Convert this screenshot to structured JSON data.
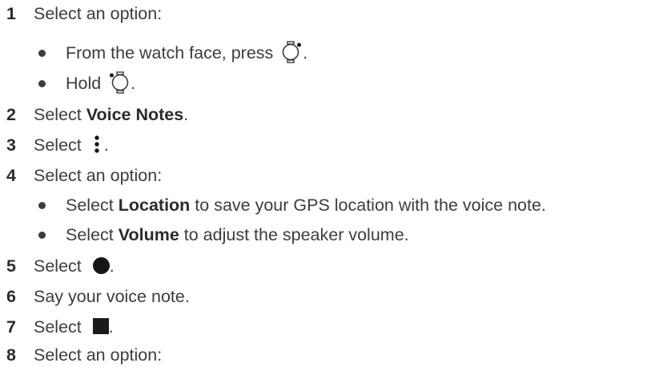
{
  "steps": [
    {
      "num": "1",
      "text": "Select an option:"
    },
    {
      "sub": {
        "pre": "From the watch face, press ",
        "post": "."
      }
    },
    {
      "sub": {
        "pre": "Hold ",
        "post": "."
      }
    },
    {
      "num": "2",
      "pre": "Select ",
      "bold": "Voice Notes",
      "post": "."
    },
    {
      "num": "3",
      "pre": "Select ",
      "post": "."
    },
    {
      "num": "4",
      "text": "Select an option:"
    },
    {
      "sub": {
        "pre": "Select ",
        "bold": "Location",
        "post": " to save your GPS location with the voice note."
      }
    },
    {
      "sub": {
        "pre": "Select ",
        "bold": "Volume",
        "post": " to adjust the speaker volume."
      }
    },
    {
      "num": "5",
      "pre": "Select ",
      "post": "."
    },
    {
      "num": "6",
      "text": "Say your voice note."
    },
    {
      "num": "7",
      "pre": "Select ",
      "post": "."
    },
    {
      "num": "8",
      "text": "Select an option:"
    }
  ],
  "icons": {
    "watch_top_right": "watch-button-top-right-icon",
    "watch_top_left": "watch-button-top-left-icon",
    "menu": "vertical-ellipsis-menu-icon",
    "record": "record-circle-icon",
    "stop": "stop-square-icon"
  }
}
